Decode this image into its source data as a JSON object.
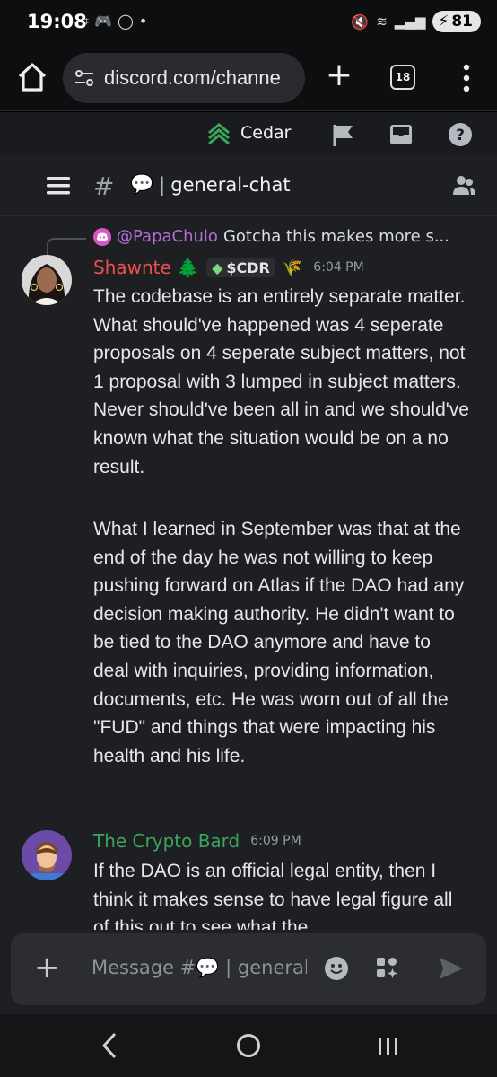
{
  "status_bar": {
    "time": "19:08",
    "battery": "81"
  },
  "browser": {
    "url": "discord.com/channe",
    "tab_count": "18"
  },
  "server": {
    "name": "Cedar"
  },
  "channel": {
    "name": "general-chat"
  },
  "messages": [
    {
      "reply_to_user": "@PapaChulo",
      "reply_text": "Gotcha this makes more s...",
      "username": "Shawnte 🌲",
      "username_color": "#f0504c",
      "tag": "$CDR",
      "tag_extra": "🌾",
      "timestamp": "6:04 PM",
      "paragraphs": [
        "The codebase is an entirely separate matter. What should've happened was 4 seperate proposals on 4 seperate subject matters,  not 1 proposal with 3 lumped in subject matters. Never should've been all in and we should've known what the situation would be on a no result.",
        "What I learned in September was that at the end of the day he was not willing to keep pushing forward on Atlas if the DAO had any decision making authority. He didn't want to be tied to the DAO anymore and have to deal with inquiries, providing information, documents, etc. He was worn out of all the \"FUD\" and things that were impacting his health and his life."
      ]
    },
    {
      "username": "The Crypto Bard",
      "username_color": "#3ba55c",
      "timestamp": "6:09 PM",
      "paragraphs": [
        "If the DAO is an official legal entity, then I think it makes sense to have legal figure all of this out to see what the"
      ]
    }
  ],
  "composer": {
    "placeholder": "Message #💬 | general-chat"
  },
  "colors": {
    "background": "#1e1f22",
    "composer": "#2b2d31",
    "timestamp": "#949ba4"
  }
}
